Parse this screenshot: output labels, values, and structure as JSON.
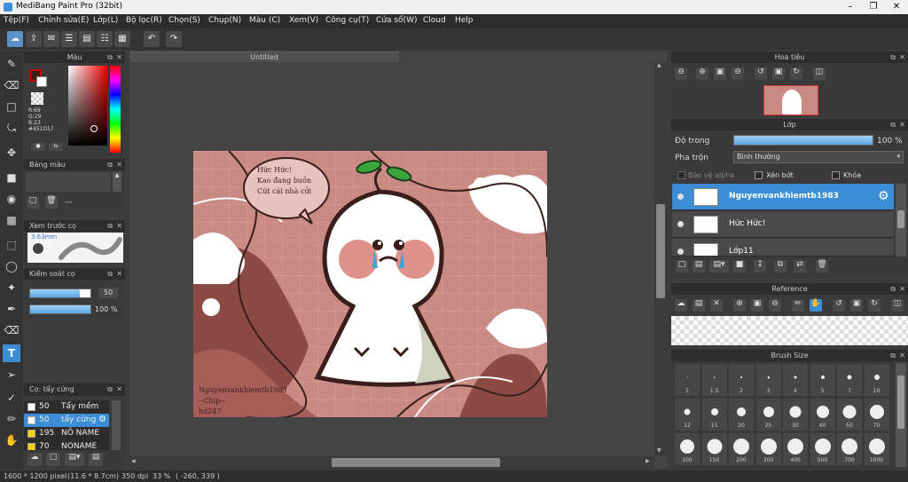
{
  "app": {
    "title": "MediBang Paint Pro (32bit)"
  },
  "menu": [
    "Tệp(F)",
    "Chỉnh sửa(E)",
    "Lớp(L)",
    "Bộ lọc(R)",
    "Chọn(S)",
    "Chụp(N)",
    "Màu (C)",
    "Xem(V)",
    "Công cụ(T)",
    "Cửa sổ(W)",
    "Cloud",
    "Help"
  ],
  "document": {
    "tab": "Untitled"
  },
  "color_panel": {
    "title": "Màu",
    "r": "R:69",
    "g": "G:29",
    "b": "B:23",
    "hex": "#451D17",
    "fg": "#451D17",
    "bg": "#ffffff"
  },
  "palette_panel": {
    "title": "Bảng màu",
    "dash": "---"
  },
  "preview_panel": {
    "title": "Xem trước cọ",
    "size": "3.63mm"
  },
  "brush_control": {
    "title": "Kiểm soát cọ",
    "size": "50",
    "opacity": "100 %"
  },
  "brush_list": {
    "title": "Cọ: tẩy cứng",
    "items": [
      {
        "size": "50",
        "name": "Tẩy mềm",
        "color": "#ffffff"
      },
      {
        "size": "50",
        "name": "tẩy cứng",
        "color": "#ffffff",
        "selected": true
      },
      {
        "size": "195",
        "name": "NÔ NAME",
        "color": "#f5d000"
      },
      {
        "size": "70",
        "name": "NONAME",
        "color": "#f5d000"
      }
    ]
  },
  "navigator": {
    "title": "Hoa tiêu"
  },
  "layer_panel": {
    "title": "Lớp",
    "opacity_label": "Độ trong",
    "opacity_value": "100 %",
    "blend_label": "Pha trộn",
    "blend_value": "Bình thường",
    "protect_alpha": "Bảo vệ alpha",
    "clip": "Xén bớt",
    "lock": "Khóa",
    "layers": [
      {
        "name": "Nguyenvankhiemtb1983",
        "selected": true
      },
      {
        "name": "Hức Hức!",
        "selected": false
      },
      {
        "name": "Lớp11",
        "selected": false
      }
    ]
  },
  "reference_panel": {
    "title": "Reference"
  },
  "brush_size_panel": {
    "title": "Brush Size",
    "sizes": [
      "1",
      "1.5",
      "2",
      "3",
      "4",
      "5",
      "7",
      "10",
      "12",
      "15",
      "20",
      "25",
      "30",
      "40",
      "50",
      "70",
      "100",
      "150",
      "200",
      "300",
      "400",
      "500",
      "700",
      "1000"
    ]
  },
  "canvas_art": {
    "speech": [
      "Hức Hức!",
      "Kao đang buồn",
      "Cút cái nhà cửi"
    ],
    "signature": [
      "Nguyenvankhiemtb1983",
      "--Chip--",
      "hd247"
    ]
  },
  "status": {
    "size": "1600 * 1200 pixel",
    "cm": "(11.6 * 8.7cm)",
    "dpi": "350 dpi",
    "zoom": "33 %",
    "coords": "( -260, 339 )"
  }
}
